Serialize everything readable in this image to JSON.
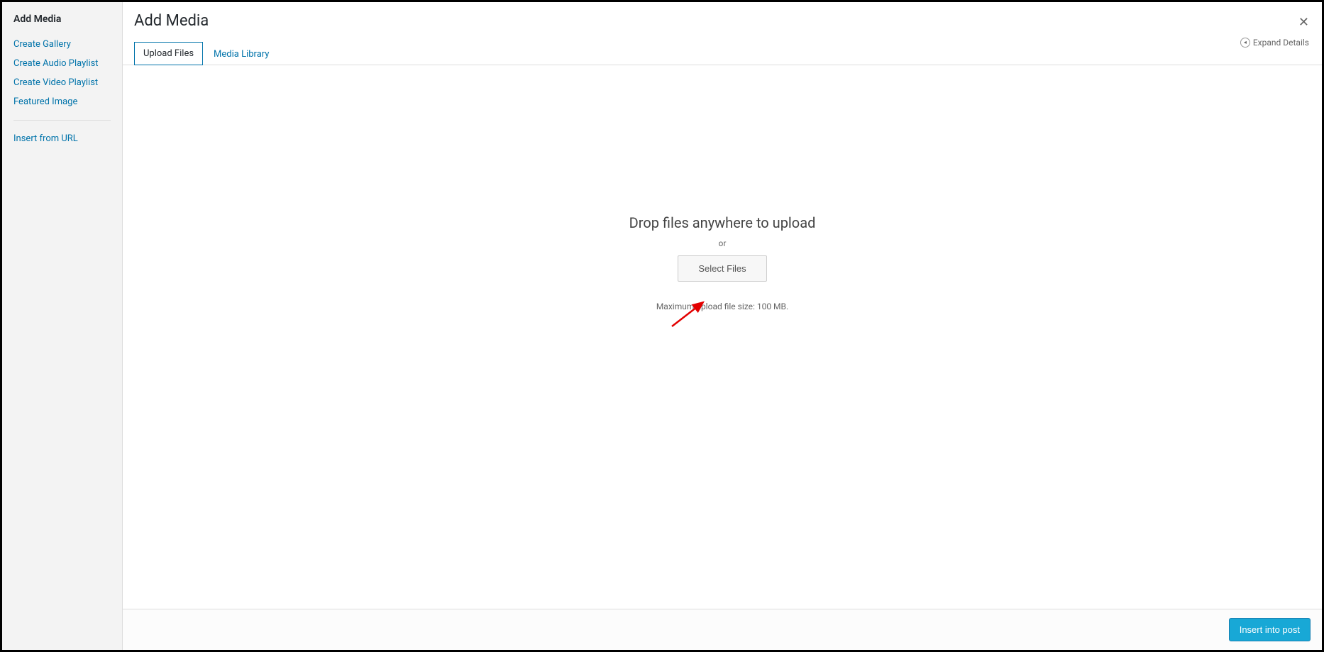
{
  "sidebar": {
    "title": "Add Media",
    "items": [
      "Create Gallery",
      "Create Audio Playlist",
      "Create Video Playlist",
      "Featured Image"
    ],
    "insert_url": "Insert from URL"
  },
  "header": {
    "title": "Add Media",
    "expand_details": "Expand Details"
  },
  "tabs": {
    "upload": "Upload Files",
    "media_library": "Media Library"
  },
  "upload": {
    "drop_message": "Drop files anywhere to upload",
    "or": "or",
    "select_button": "Select Files",
    "max_size": "Maximum upload file size: 100 MB."
  },
  "footer": {
    "insert_button": "Insert into post"
  }
}
